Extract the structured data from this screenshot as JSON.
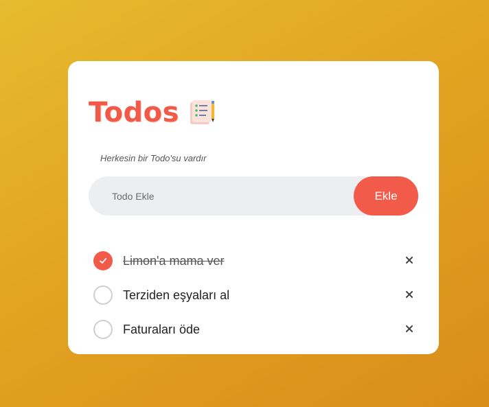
{
  "app": {
    "title": "Todos",
    "title_icon": "notepad-pencil-icon",
    "subtitle": "Herkesin bir Todo'su vardır"
  },
  "add": {
    "placeholder": "Todo Ekle",
    "value": "",
    "button_label": "Ekle"
  },
  "todos": [
    {
      "text": "Limon'a mama ver",
      "done": true,
      "delete_icon": "close-icon"
    },
    {
      "text": "Terziden eşyaları al",
      "done": false,
      "delete_icon": "close-icon"
    },
    {
      "text": "Faturaları öde",
      "done": false,
      "delete_icon": "close-icon"
    }
  ],
  "colors": {
    "accent": "#f25a4a",
    "background_start": "#e6bb2e",
    "background_end": "#d98d1a",
    "card": "#ffffff",
    "input_bg": "#edeef0"
  }
}
